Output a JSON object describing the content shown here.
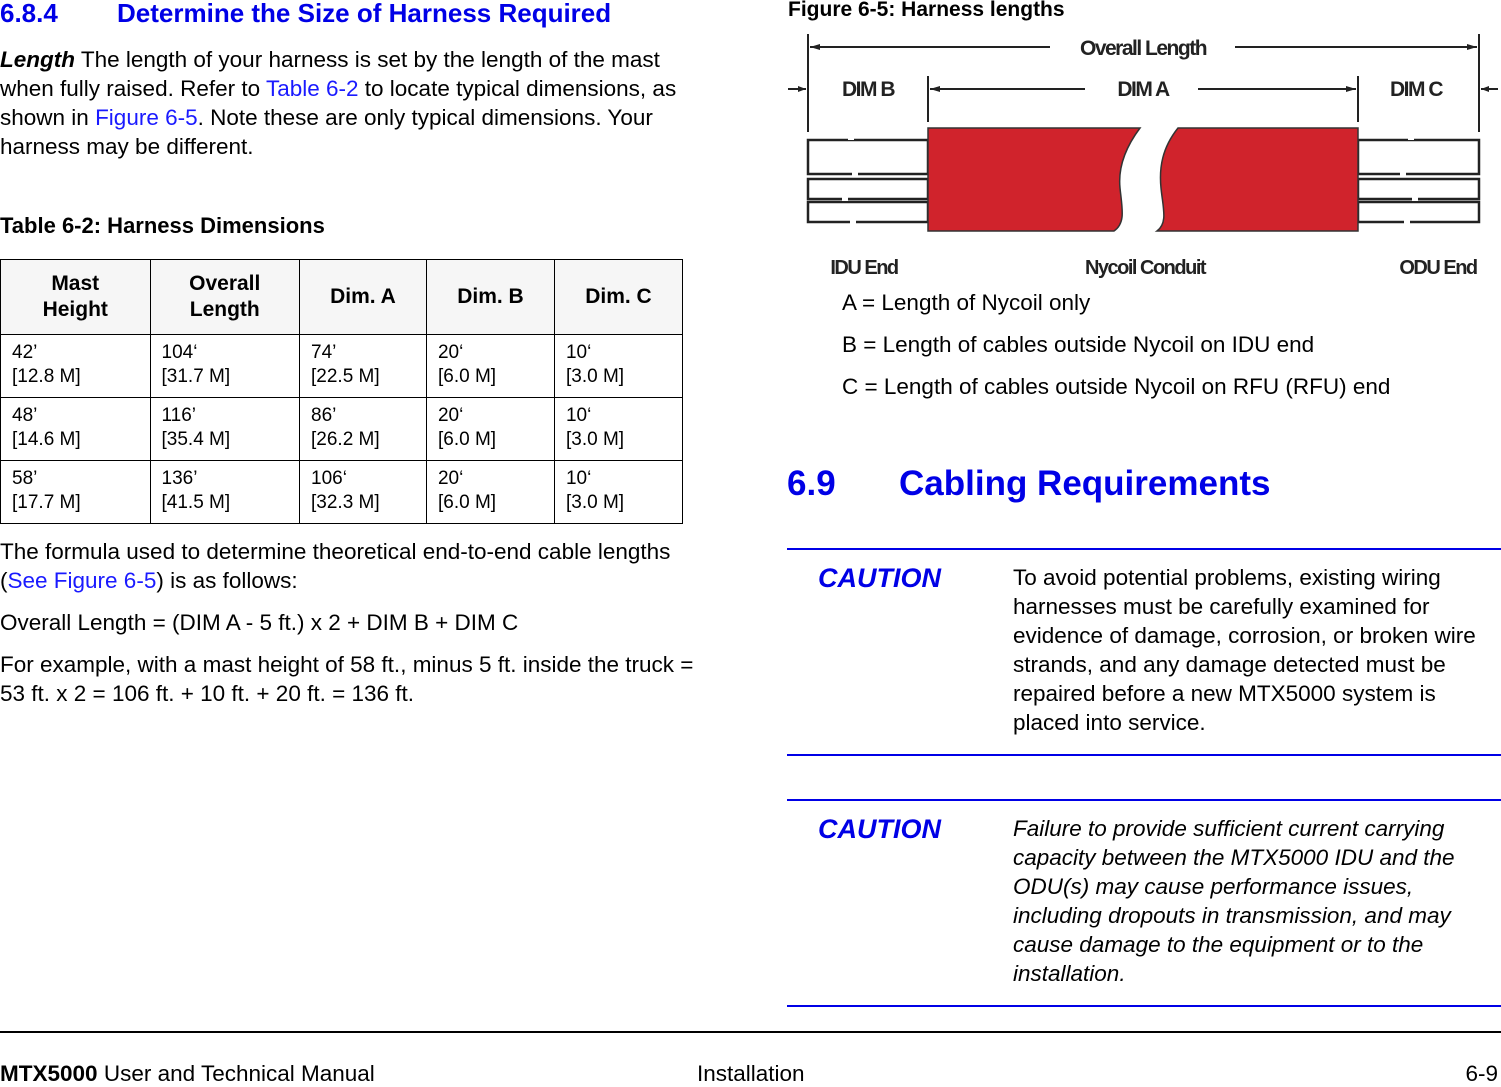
{
  "section": {
    "number": "6.8.4",
    "title": "Determine the Size of Harness Required",
    "intro": {
      "lead": "Length",
      "text1": "  The length of your harness is set by the length of the mast when fully raised.  Refer to ",
      "link1": "Table 6-2",
      "text2": " to locate typical dimensions, as shown in ",
      "link2": "Figure 6-5",
      "text3": ".  Note these are only typical dimensions.  Your harness may be different."
    }
  },
  "table": {
    "caption": "Table 6-2:   Harness Dimensions",
    "headers": [
      {
        "line1": "Mast",
        "line2": "Height"
      },
      {
        "line1": "Overall",
        "line2": "Length"
      },
      {
        "line1": "Dim. A",
        "line2": ""
      },
      {
        "line1": "Dim. B",
        "line2": ""
      },
      {
        "line1": "Dim. C",
        "line2": ""
      }
    ],
    "rows": [
      [
        {
          "ft": "42’",
          "m": "[12.8 M]"
        },
        {
          "ft": "104‘",
          "m": "[31.7 M]"
        },
        {
          "ft": "74’",
          "m": "[22.5 M]"
        },
        {
          "ft": "20‘",
          "m": "[6.0 M]"
        },
        {
          "ft": "10‘",
          "m": "[3.0 M]"
        }
      ],
      [
        {
          "ft": "48’",
          "m": "[14.6 M]"
        },
        {
          "ft": "116’",
          "m": "[35.4 M]"
        },
        {
          "ft": "86’",
          "m": "[26.2 M]"
        },
        {
          "ft": "20‘",
          "m": "[6.0 M]"
        },
        {
          "ft": "10‘",
          "m": "[3.0 M]"
        }
      ],
      [
        {
          "ft": "58’",
          "m": "[17.7 M]"
        },
        {
          "ft": "136’",
          "m": "[41.5 M]"
        },
        {
          "ft": "106‘",
          "m": "[32.3 M]"
        },
        {
          "ft": "20‘",
          "m": "[6.0 M]"
        },
        {
          "ft": "10‘",
          "m": "[3.0 M]"
        }
      ]
    ]
  },
  "formula": {
    "intro_pre": "The formula used to determine theoretical end-to-end cable lengths (",
    "intro_link": "See Figure 6-5",
    "intro_post": ") is as follows:",
    "equation": "Overall Length = (DIM A - 5 ft.) x 2 + DIM B + DIM C",
    "example": "For example, with a mast height of 58 ft., minus 5 ft. inside the truck = 53 ft. x 2 = 106 ft. + 10 ft. + 20 ft. = 136 ft."
  },
  "figure": {
    "caption": "Figure 6-5:   Harness lengths",
    "labels": {
      "overall": "Overall Length",
      "dim_b": "DIM B",
      "dim_a": "DIM A",
      "dim_c": "DIM C",
      "idu_end": "IDU End",
      "conduit": "Nycoil Conduit",
      "odu_end": "ODU End"
    },
    "conduit_color": "#d0232c",
    "legend": [
      "A = Length of Nycoil only",
      "B = Length of cables outside Nycoil on IDU end",
      "C = Length of cables outside Nycoil on RFU (RFU) end"
    ]
  },
  "cabling": {
    "number": "6.9",
    "title": "Cabling Requirements",
    "cautions": [
      {
        "label": "CAUTION",
        "text": "To avoid potential problems, existing wiring harnesses must be carefully examined for evidence of damage, corrosion, or broken wire strands, and any damage detected must be repaired before a new MTX5000 system is placed into service."
      },
      {
        "label": "CAUTION",
        "text": "Failure to provide sufficient current carrying capacity between the MTX5000 IDU and the ODU(s) may cause performance issues, including dropouts in transmission, and may cause damage to the equipment or to the installation."
      }
    ]
  },
  "footer": {
    "product": "MTX5000",
    "manual": " User and Technical Manual",
    "chapter": "Installation",
    "page": "6-9"
  }
}
